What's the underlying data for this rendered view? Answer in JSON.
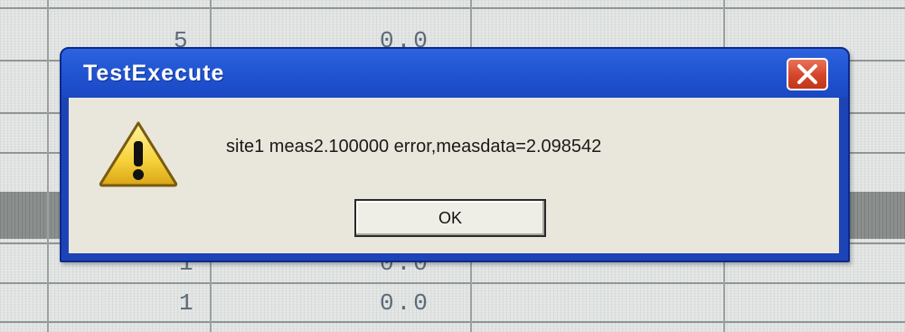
{
  "background_sheet": {
    "cells": [
      {
        "col_a": "5",
        "col_b": "0.0"
      },
      {
        "col_a": "1",
        "col_b": "0.0"
      },
      {
        "col_a": "1",
        "col_b": "0.0"
      }
    ]
  },
  "dialog": {
    "title": "TestExecute",
    "icon": "warning-icon",
    "message": "site1 meas2.100000 error,measdata=2.098542",
    "ok_label": "OK",
    "close_icon": "close-icon"
  },
  "colors": {
    "titlebar_blue": "#245ad6",
    "close_red": "#d4452a",
    "client_bg": "#e9e7dc",
    "warning_yellow": "#f6d23a"
  }
}
